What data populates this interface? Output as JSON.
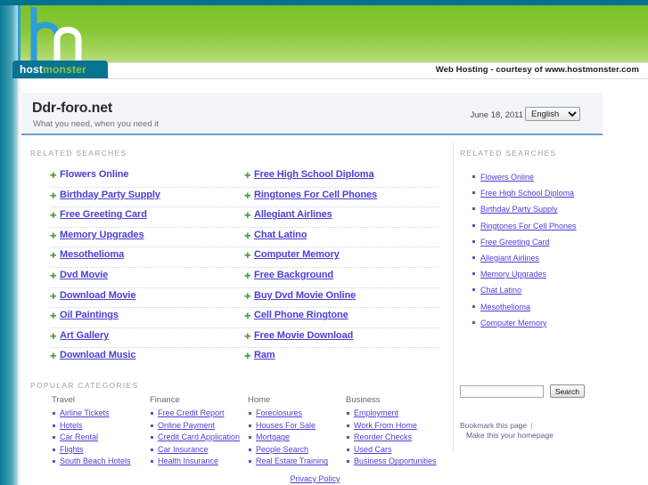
{
  "banner": {
    "logo_text_host": "host",
    "logo_text_monster": "monster",
    "courtesy": "Web Hosting - courtesy of www.hostmonster.com"
  },
  "title_panel": {
    "site_title": "Ddr-foro.net",
    "tagline": "What you need, when you need it",
    "date": "June 18, 2011",
    "language_selected": "English",
    "language_options": [
      "English"
    ]
  },
  "sections": {
    "related_searches_label": "RELATED SEARCHES",
    "popular_categories_label": "POPULAR CATEGORIES",
    "sidebar_related_label": "RELATED SEARCHES"
  },
  "related_links": [
    {
      "left": "Flowers Online",
      "right": "Free High School Diploma"
    },
    {
      "left": "Birthday Party Supply",
      "right": "Ringtones For Cell Phones"
    },
    {
      "left": "Free Greeting Card",
      "right": "Allegiant Airlines"
    },
    {
      "left": "Memory Upgrades",
      "right": "Chat Latino"
    },
    {
      "left": "Mesothelioma",
      "right": "Computer Memory"
    },
    {
      "left": "Dvd Movie",
      "right": "Free Background"
    },
    {
      "left": "Download Movie",
      "right": "Buy Dvd Movie Online"
    },
    {
      "left": "Oil Paintings",
      "right": "Cell Phone Ringtone"
    },
    {
      "left": "Art Gallery",
      "right": "Free Movie Download"
    },
    {
      "left": "Download Music",
      "right": "Ram"
    }
  ],
  "categories": [
    {
      "heading": "Travel",
      "items": [
        "Airline Tickets",
        "Hotels",
        "Car Rental",
        "Flights",
        "South Beach Hotels"
      ]
    },
    {
      "heading": "Finance",
      "items": [
        "Free Credit Report",
        "Online Payment",
        "Credit Card Application",
        "Car Insurance",
        "Health Insurance"
      ]
    },
    {
      "heading": "Home",
      "items": [
        "Foreclosures",
        "Houses For Sale",
        "Mortgage",
        "People Search",
        "Real Estate Training"
      ]
    },
    {
      "heading": "Business",
      "items": [
        "Employment",
        "Work From Home",
        "Reorder Checks",
        "Used Cars",
        "Business Opportunities"
      ]
    }
  ],
  "sidebar_links": [
    "Flowers Online",
    "Free High School Diploma",
    "Birthday Party Supply",
    "Ringtones For Cell Phones",
    "Free Greeting Card",
    "Allegiant Airlines",
    "Memory Upgrades",
    "Chat Latino",
    "Mesothelioma",
    "Computer Memory"
  ],
  "search": {
    "value": "",
    "placeholder": "",
    "button_label": "Search"
  },
  "bookmark": {
    "bookmark_label": "Bookmark this page",
    "separator": "|",
    "homepage_label": "Make this your homepage"
  },
  "footer": {
    "privacy_policy": "Privacy Policy"
  },
  "colors": {
    "teal": "#05718e",
    "green": "#8cc63f",
    "link": "#4b3fd4",
    "panel_bg": "#f2f6f9",
    "panel_border": "#6f9fc8"
  }
}
